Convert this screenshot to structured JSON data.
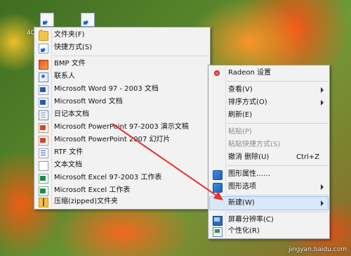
{
  "desktop": {
    "icon_label_fragment": "40",
    "watermark": "jingyan.baidu.com"
  },
  "new_submenu": {
    "items": [
      {
        "label": "文件夹(F)",
        "icon": "folder-icon"
      },
      {
        "label": "快捷方式(S)",
        "icon": "shortcut-icon"
      },
      {
        "label": "BMP 文件",
        "icon": "bmp-image-icon"
      },
      {
        "label": "联系人",
        "icon": "contact-icon"
      },
      {
        "label": "Microsoft Word 97 - 2003 文档",
        "icon": "word-document-icon"
      },
      {
        "label": "Microsoft Word 文档",
        "icon": "word-document-icon"
      },
      {
        "label": "日记本文档",
        "icon": "journal-document-icon"
      },
      {
        "label": "Microsoft PowerPoint 97-2003 演示文稿",
        "icon": "powerpoint-icon"
      },
      {
        "label": "Microsoft PowerPoint 2007 幻灯片",
        "icon": "powerpoint-icon"
      },
      {
        "label": "RTF 文件",
        "icon": "rtf-document-icon"
      },
      {
        "label": "文本文档",
        "icon": "text-document-icon"
      },
      {
        "label": "Microsoft Excel 97-2003 工作表",
        "icon": "excel-icon"
      },
      {
        "label": "Microsoft Excel 工作表",
        "icon": "excel-icon"
      },
      {
        "label": "压缩(zipped)文件夹",
        "icon": "zip-folder-icon"
      }
    ]
  },
  "context_menu": {
    "radeon": "Radeon 设置",
    "view": "查看(V)",
    "sort_by": "排序方式(O)",
    "refresh": "刷新(E)",
    "paste": "粘贴(P)",
    "paste_shortcut": "粘贴快捷方式(S)",
    "undo_delete": "撤消 删除(U)",
    "undo_shortcut": "Ctrl+Z",
    "graphics_properties": "图形属性……",
    "graphics_options": "图形选项",
    "new": "新建(W)",
    "screen_resolution": "屏幕分辨率(C)",
    "personalize": "个性化(R)"
  },
  "colors": {
    "highlight": "#d9e8fb",
    "arrow": "#e8322a"
  }
}
